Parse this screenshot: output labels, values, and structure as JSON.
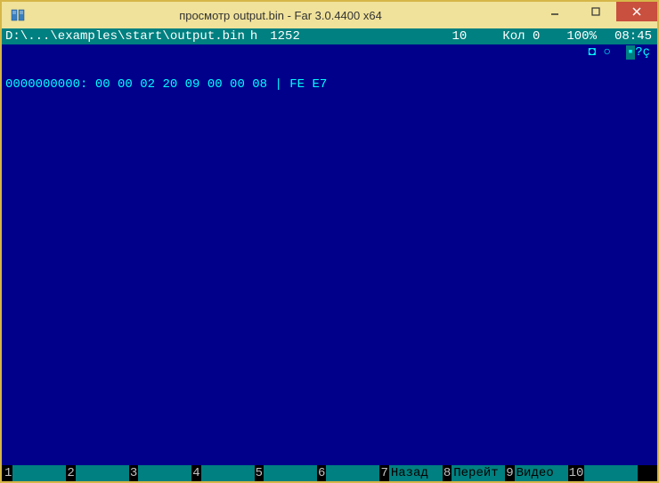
{
  "window": {
    "title": "просмотр output.bin - Far 3.0.4400 x64"
  },
  "status": {
    "path": "D:\\...\\examples\\start\\output.bin",
    "mode": "h",
    "codepage": "1252",
    "size": "10",
    "col_label": "Кол",
    "col_value": "0",
    "percent": "100%",
    "time": "08:45"
  },
  "hex": {
    "offset": "0000000000:",
    "bytes_left": "00 00 02 20 09 00 00 08",
    "separator": "|",
    "bytes_right": "FE E7",
    "ascii_prefix": "◘ ○",
    "ascii_hl": "▪",
    "ascii_suffix": "?ç"
  },
  "keybar": {
    "keys": [
      {
        "num": "1",
        "label": ""
      },
      {
        "num": "2",
        "label": ""
      },
      {
        "num": "3",
        "label": ""
      },
      {
        "num": "4",
        "label": ""
      },
      {
        "num": "5",
        "label": ""
      },
      {
        "num": "6",
        "label": ""
      },
      {
        "num": "7",
        "label": "Назад"
      },
      {
        "num": "8",
        "label": "Перейт"
      },
      {
        "num": "9",
        "label": "Видео"
      },
      {
        "num": "10",
        "label": ""
      }
    ]
  }
}
